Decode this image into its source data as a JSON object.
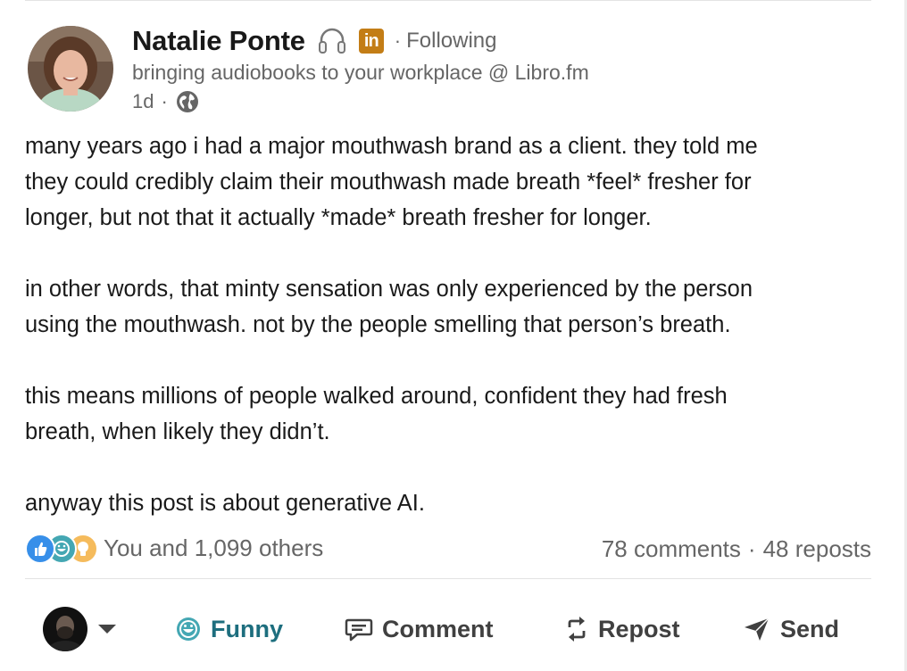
{
  "author": {
    "name": "Natalie Ponte",
    "follow_status": "Following",
    "headline": "bringing audiobooks to your workplace @ Libro.fm",
    "timestamp": "1d",
    "separator": "·",
    "icons": [
      "headphones-icon",
      "linkedin-icon",
      "globe-icon"
    ]
  },
  "post": {
    "paragraphs": [
      "many years ago i had a major mouthwash brand as a client. they told me\nthey could credibly claim their mouthwash made breath *feel* fresher for\nlonger, but not that it actually *made* breath fresher for longer.",
      "in other words, that minty sensation was only experienced by the person\nusing the mouthwash. not by the people smelling that person’s breath.",
      "this means millions of people walked around, confident they had fresh\nbreath, when likely they didn’t.",
      "anyway this post is about generative AI."
    ]
  },
  "social": {
    "reactions_text": "You and 1,099 others",
    "reaction_icons": [
      "like-icon",
      "funny-icon",
      "insightful-icon"
    ],
    "comments": "78 comments",
    "separator": "·",
    "reposts": "48 reposts"
  },
  "actions": {
    "funny": "Funny",
    "comment": "Comment",
    "repost": "Repost",
    "send": "Send"
  },
  "colors": {
    "funny_accent": "#1d6e7e",
    "linkedin_badge": "#c37d16",
    "muted_text": "#666666",
    "body_text": "#1a1a1a"
  }
}
